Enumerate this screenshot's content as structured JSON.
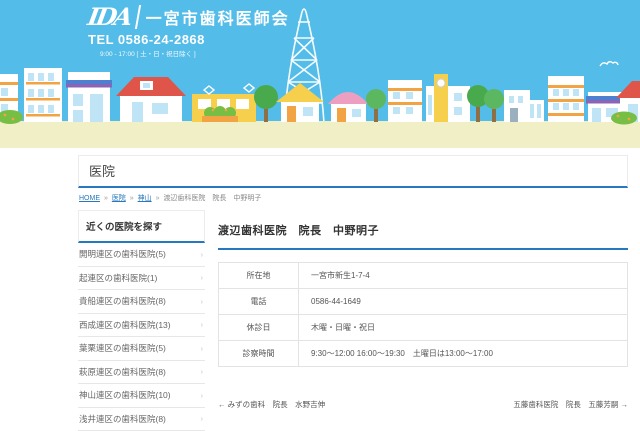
{
  "header": {
    "logo_text": "IDA",
    "org_name": "一宮市歯科医師会",
    "tel": "TEL 0586-24-2868",
    "hours_note": "9:00 - 17:00 [ 土・日・祝日除く ]"
  },
  "page": {
    "title": "医院"
  },
  "breadcrumb": {
    "separator": "»",
    "items": [
      {
        "label": "HOME"
      },
      {
        "label": "医院"
      },
      {
        "label": "神山"
      },
      {
        "label": "渡辺歯科医院　院長　中野明子"
      }
    ]
  },
  "sidebar": {
    "title": "近くの医院を探す",
    "chevron": "›",
    "items": [
      {
        "label": "開明連区の歯科医院(5)"
      },
      {
        "label": "起連区の歯科医院(1)"
      },
      {
        "label": "貴船連区の歯科医院(8)"
      },
      {
        "label": "西成連区の歯科医院(13)"
      },
      {
        "label": "葉栗連区の歯科医院(5)"
      },
      {
        "label": "萩原連区の歯科医院(8)"
      },
      {
        "label": "神山連区の歯科医院(10)"
      },
      {
        "label": "浅井連区の歯科医院(8)"
      }
    ]
  },
  "main": {
    "title": "渡辺歯科医院　院長　中野明子",
    "table": {
      "rows": [
        {
          "label": "所在地",
          "value": "一宮市新生1-7-4"
        },
        {
          "label": "電話",
          "value": "0586-44-1649"
        },
        {
          "label": "休診日",
          "value": "木曜・日曜・祝日"
        },
        {
          "label": "診察時間",
          "value": "9:30～12:00 16:00～19:30　土曜日は13:00～17:00"
        }
      ]
    },
    "pagination": {
      "prev": "← みずの歯科　院長　水野吉伸",
      "next": "五藤歯科医院　院長　五藤芳嗣 →"
    }
  },
  "colors": {
    "sky_blue": "#53bce8",
    "ground": "#f0efc6",
    "accent_blue": "#2778bd",
    "roof_red": "#df5549",
    "roof_pink": "#ec9fc0",
    "building_yellow": "#f6cf4d",
    "stripe_orange": "#f2a444",
    "tree_green": "#49a94d"
  }
}
